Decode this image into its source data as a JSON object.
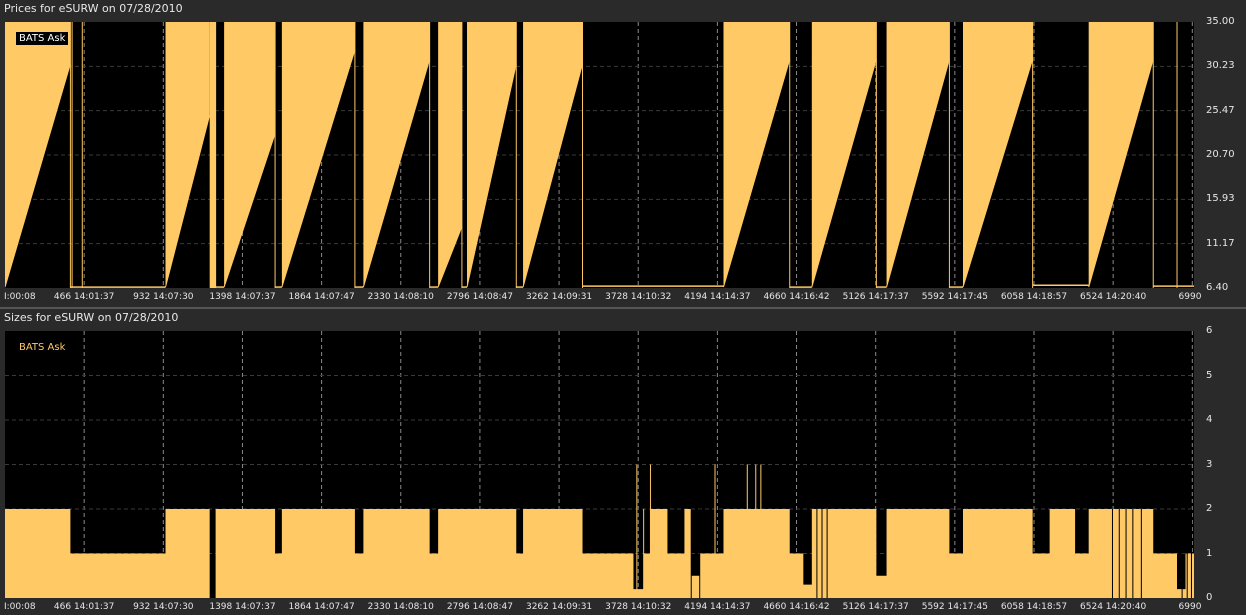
{
  "top": {
    "title": "Prices for  eSURW  on  07/28/2010",
    "legend": "BATS Ask",
    "yticks": [
      "35.00",
      "30.23",
      "25.47",
      "20.70",
      "15.93",
      "11.17",
      "6.40"
    ],
    "xticks": [
      "I:00:08",
      "466 14:01:37",
      "932 14:07:30",
      "1398 14:07:37",
      "1864 14:07:47",
      "2330 14:08:10",
      "2796 14:08:47",
      "3262 14:09:31",
      "3728 14:10:32",
      "4194 14:14:37",
      "4660 14:16:42",
      "5126 14:17:37",
      "5592 14:17:45",
      "6058 14:18:57",
      "6524 14:20:40",
      "6990 "
    ]
  },
  "bottom": {
    "title": "Sizes for  eSURW  on  07/28/2010",
    "legend": "BATS Ask",
    "yticks": [
      "6",
      "5",
      "4",
      "3",
      "2",
      "1",
      "0"
    ],
    "xticks": [
      "I:00:08",
      "466 14:01:37",
      "932 14:07:30",
      "1398 14:07:37",
      "1864 14:07:47",
      "2330 14:08:10",
      "2796 14:08:47",
      "3262 14:09:31",
      "3728 14:10:32",
      "4194 14:14:37",
      "4660 14:16:42",
      "5126 14:17:37",
      "5592 14:17:45",
      "6058 14:18:57",
      "6524 14:20:40",
      "6990 "
    ]
  },
  "colors": {
    "fill": "#ffc966",
    "bg": "#000000",
    "grid": "#8a8a8a"
  },
  "chart_data": [
    {
      "type": "area",
      "title": "Prices for  eSURW  on  07/28/2010",
      "ylim": [
        6.4,
        35.0
      ],
      "xlim": [
        0,
        7000
      ],
      "series": [
        {
          "name": "BATS Ask",
          "segments": [
            {
              "x0": 0,
              "x1": 385,
              "kind": "ramp",
              "y0": 6.5,
              "y1": 30.5
            },
            {
              "x0": 385,
              "x1": 395,
              "kind": "flat",
              "y0": 6.5
            },
            {
              "x0": 395,
              "x1": 455,
              "kind": "flat",
              "y0": 6.5
            },
            {
              "x0": 455,
              "x1": 945,
              "kind": "flat",
              "y0": 6.5
            },
            {
              "x0": 945,
              "x1": 1205,
              "kind": "ramp",
              "y0": 6.5,
              "y1": 25.0
            },
            {
              "x0": 1205,
              "x1": 1240,
              "kind": "full"
            },
            {
              "x0": 1240,
              "x1": 1290,
              "kind": "flat",
              "y0": 6.5
            },
            {
              "x0": 1290,
              "x1": 1590,
              "kind": "ramp",
              "y0": 6.5,
              "y1": 23.0
            },
            {
              "x0": 1590,
              "x1": 1630,
              "kind": "flat",
              "y0": 6.5
            },
            {
              "x0": 1630,
              "x1": 2060,
              "kind": "ramp",
              "y0": 6.5,
              "y1": 32.0
            },
            {
              "x0": 2060,
              "x1": 2110,
              "kind": "flat",
              "y0": 6.5
            },
            {
              "x0": 2110,
              "x1": 2500,
              "kind": "ramp",
              "y0": 6.5,
              "y1": 31.0
            },
            {
              "x0": 2500,
              "x1": 2550,
              "kind": "flat",
              "y0": 6.5
            },
            {
              "x0": 2550,
              "x1": 2690,
              "kind": "ramp",
              "y0": 6.5,
              "y1": 13.0
            },
            {
              "x0": 2690,
              "x1": 2720,
              "kind": "flat",
              "y0": 6.5
            },
            {
              "x0": 2720,
              "x1": 3010,
              "kind": "ramp",
              "y0": 6.5,
              "y1": 30.5
            },
            {
              "x0": 3010,
              "x1": 3050,
              "kind": "flat",
              "y0": 6.5
            },
            {
              "x0": 3050,
              "x1": 3400,
              "kind": "ramp",
              "y0": 6.5,
              "y1": 30.5
            },
            {
              "x0": 3400,
              "x1": 4230,
              "kind": "flat",
              "y0": 6.6
            },
            {
              "x0": 4230,
              "x1": 4620,
              "kind": "ramp",
              "y0": 6.5,
              "y1": 31.0
            },
            {
              "x0": 4620,
              "x1": 4750,
              "kind": "flat",
              "y0": 6.5
            },
            {
              "x0": 4750,
              "x1": 5130,
              "kind": "ramp",
              "y0": 6.5,
              "y1": 31.0
            },
            {
              "x0": 5130,
              "x1": 5190,
              "kind": "flat",
              "y0": 6.5
            },
            {
              "x0": 5190,
              "x1": 5560,
              "kind": "ramp",
              "y0": 6.5,
              "y1": 31.0
            },
            {
              "x0": 5560,
              "x1": 5640,
              "kind": "flat",
              "y0": 6.5
            },
            {
              "x0": 5640,
              "x1": 6050,
              "kind": "ramp",
              "y0": 6.5,
              "y1": 31.0
            },
            {
              "x0": 6050,
              "x1": 6380,
              "kind": "flat",
              "y0": 6.7
            },
            {
              "x0": 6380,
              "x1": 6760,
              "kind": "ramp",
              "y0": 6.5,
              "y1": 31.0
            },
            {
              "x0": 6760,
              "x1": 6900,
              "kind": "flat",
              "y0": 6.6
            },
            {
              "x0": 6900,
              "x1": 7000,
              "kind": "flat",
              "y0": 6.6
            }
          ]
        }
      ]
    },
    {
      "type": "area",
      "title": "Sizes for  eSURW  on  07/28/2010",
      "ylim": [
        0,
        6
      ],
      "xlim": [
        0,
        7000
      ],
      "series": [
        {
          "name": "BATS Ask",
          "steps": [
            [
              0,
              2
            ],
            [
              385,
              1
            ],
            [
              945,
              2
            ],
            [
              1205,
              0
            ],
            [
              1240,
              2
            ],
            [
              1590,
              1
            ],
            [
              1630,
              2
            ],
            [
              2060,
              1
            ],
            [
              2110,
              2
            ],
            [
              2500,
              1
            ],
            [
              2550,
              2
            ],
            [
              3010,
              1
            ],
            [
              3050,
              2
            ],
            [
              3400,
              1
            ],
            [
              3700,
              0.2
            ],
            [
              3760,
              1
            ],
            [
              3800,
              2
            ],
            [
              3900,
              1
            ],
            [
              4000,
              2
            ],
            [
              4040,
              0.5
            ],
            [
              4090,
              1
            ],
            [
              4230,
              2
            ],
            [
              4620,
              1
            ],
            [
              4700,
              0.3
            ],
            [
              4750,
              2
            ],
            [
              5130,
              0.5
            ],
            [
              5190,
              2
            ],
            [
              5560,
              1
            ],
            [
              5640,
              2
            ],
            [
              6050,
              1
            ],
            [
              6150,
              2
            ],
            [
              6300,
              1
            ],
            [
              6380,
              2
            ],
            [
              6760,
              1
            ],
            [
              6900,
              0.2
            ],
            [
              6950,
              1
            ],
            [
              7000,
              1
            ]
          ]
        }
      ]
    }
  ]
}
